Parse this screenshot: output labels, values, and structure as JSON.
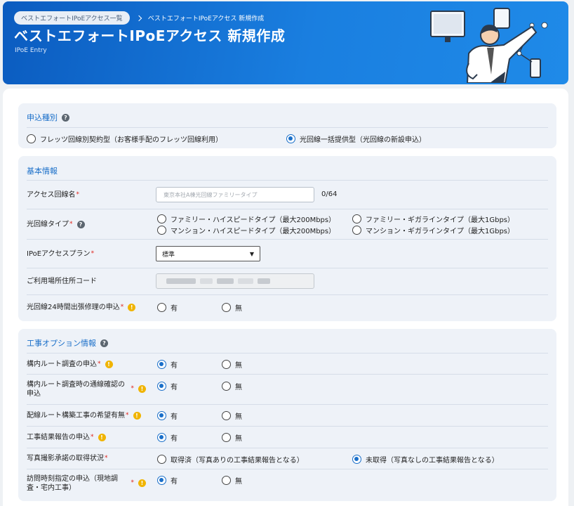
{
  "header": {
    "breadcrumb_parent": "ベストエフォートIPoEアクセス一覧",
    "breadcrumb_current": "ベストエフォートIPoEアクセス 新規作成",
    "title": "ベストエフォートIPoEアクセス 新規作成",
    "subtitle": "IPoE Entry"
  },
  "application_type": {
    "title": "申込種別",
    "options": [
      "フレッツ回線別契約型（お客様手配のフレッツ回線利用）",
      "光回線一括提供型（光回線の新設申込）"
    ],
    "selected_index": 1
  },
  "basic_info": {
    "title": "基本情報",
    "line_name_label": "アクセス回線名",
    "line_name_placeholder": "東京本社A棟光回線ファミリータイプ",
    "line_name_counter": "0/64",
    "line_type_label": "光回線タイプ",
    "line_type_options": [
      "ファミリー・ハイスピードタイプ（最大200Mbps）",
      "ファミリー・ギガラインタイプ（最大1Gbps）",
      "マンション・ハイスピードタイプ（最大200Mbps）",
      "マンション・ギガラインタイプ（最大1Gbps）"
    ],
    "plan_label": "IPoEアクセスプラン",
    "plan_value": "標準",
    "address_label": "ご利用場所住所コード",
    "repair_label": "光回線24時間出張修理の申込",
    "repair_options": [
      "有",
      "無"
    ],
    "repair_selected": null
  },
  "construction": {
    "title": "工事オプション情報",
    "rows": [
      {
        "label": "構内ルート調査の申込",
        "options": [
          "有",
          "無"
        ],
        "selected_index": 0
      },
      {
        "label": "構内ルート調査時の通線確認の申込",
        "options": [
          "有",
          "無"
        ],
        "selected_index": 0
      },
      {
        "label": "配線ルート構築工事の希望有無",
        "options": [
          "有",
          "無"
        ],
        "selected_index": 0
      },
      {
        "label": "工事結果報告の申込",
        "options": [
          "有",
          "無"
        ],
        "selected_index": 0
      },
      {
        "label": "写真撮影承諾の取得状況",
        "options": [
          "取得済（写真ありの工事結果報告となる）",
          "未取得（写真なしの工事結果報告となる）"
        ],
        "selected_index": 1
      },
      {
        "label": "訪問時刻指定の申込（現地調査・宅内工事）",
        "options": [
          "有",
          "無"
        ],
        "selected_index": 0
      }
    ]
  },
  "required_mark": "*",
  "colors": {
    "accent": "#1a6fc9",
    "header_bg": "#1a7fe0",
    "required": "#e0241b",
    "warning": "#f0b400"
  }
}
